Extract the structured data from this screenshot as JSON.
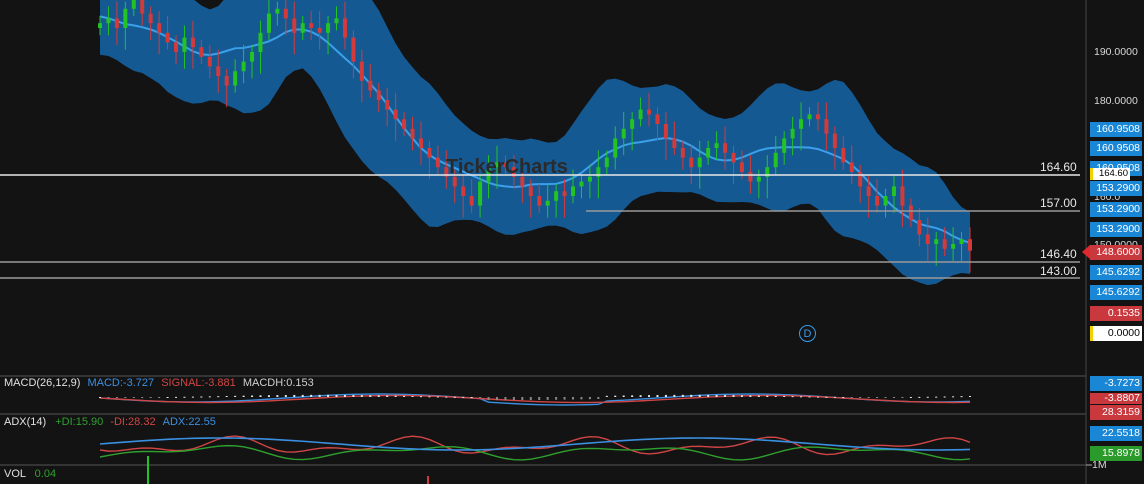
{
  "watermark": "TickerCharts",
  "price_axis": {
    "ticks": [
      "190.0000",
      "180.0000",
      "160.0",
      "150.0000"
    ]
  },
  "horizontal_lines": [
    {
      "label": "164.60",
      "value": 164.6
    },
    {
      "label": "157.00",
      "value": 157.0
    },
    {
      "label": "146.40",
      "value": 146.4
    },
    {
      "label": "143.00",
      "value": 143.0
    }
  ],
  "price_tags": [
    {
      "text": "160.9508",
      "color": "blue"
    },
    {
      "text": "160.9508",
      "color": "blue"
    },
    {
      "text": "160.9508",
      "color": "blue"
    },
    {
      "text": "164.60",
      "color": "white"
    },
    {
      "text": "153.2900",
      "color": "blue"
    },
    {
      "text": "153.2900",
      "color": "blue"
    },
    {
      "text": "153.2900",
      "color": "blue"
    },
    {
      "text": "148.6000",
      "color": "red"
    },
    {
      "text": "145.6292",
      "color": "blue"
    },
    {
      "text": "145.6292",
      "color": "blue"
    }
  ],
  "event_marker": "D",
  "macd": {
    "label": "MACD(26,12,9)",
    "macd_text": "MACD:-3.727",
    "signal_text": "SIGNAL:-3.881",
    "hist_text": "MACDH:0.153",
    "tags": [
      {
        "text": "0.1535",
        "color": "red"
      },
      {
        "text": "0.0000",
        "color": "white"
      },
      {
        "text": "-3.7273",
        "color": "blue"
      },
      {
        "text": "-3.8807",
        "color": "red"
      }
    ]
  },
  "adx": {
    "label": "ADX(14)",
    "plus_di_text": "+DI:15.90",
    "minus_di_text": "-DI:28.32",
    "adx_text": "ADX:22.55",
    "tags": [
      {
        "text": "28.3159",
        "color": "red"
      },
      {
        "text": "22.5518",
        "color": "blue"
      },
      {
        "text": "15.8978",
        "color": "green"
      }
    ]
  },
  "vol": {
    "label": "VOL",
    "value_text": "0.04",
    "axis_tick": "1M"
  },
  "colors": {
    "up": "#22c322",
    "down": "#d43a3a",
    "band_fill": "#1666aa",
    "band_mid": "#3aa0ea",
    "macd": "#3a8fe0",
    "signal": "#d04545",
    "plus_di": "#2fa02f",
    "minus_di": "#d04545",
    "adx": "#3a8fe0"
  },
  "chart_data": {
    "type": "candlestick",
    "price_scale_ticks": [
      190,
      180,
      160,
      150
    ],
    "last_price": 148.6,
    "closes": [
      196,
      197,
      195,
      199,
      201,
      198,
      196,
      194,
      192,
      190,
      193,
      191,
      189,
      187,
      185,
      183,
      186,
      188,
      190,
      194,
      198,
      199,
      197,
      194,
      196,
      195,
      194,
      196,
      197,
      193,
      188,
      184,
      182,
      180,
      178,
      176,
      174,
      172,
      170,
      168,
      166,
      164,
      162,
      160,
      158,
      163,
      166,
      167,
      166,
      164,
      162,
      160,
      158,
      159,
      161,
      160,
      162,
      163,
      164,
      166,
      168,
      172,
      174,
      176,
      178,
      177,
      175,
      172,
      170,
      168,
      166,
      168,
      170,
      171,
      169,
      167,
      165,
      163,
      164,
      166,
      169,
      172,
      174,
      176,
      177,
      176,
      173,
      170,
      167,
      165,
      162,
      160,
      158,
      160,
      162,
      158,
      155,
      152,
      150,
      151,
      149,
      150,
      151,
      148.6
    ]
  }
}
